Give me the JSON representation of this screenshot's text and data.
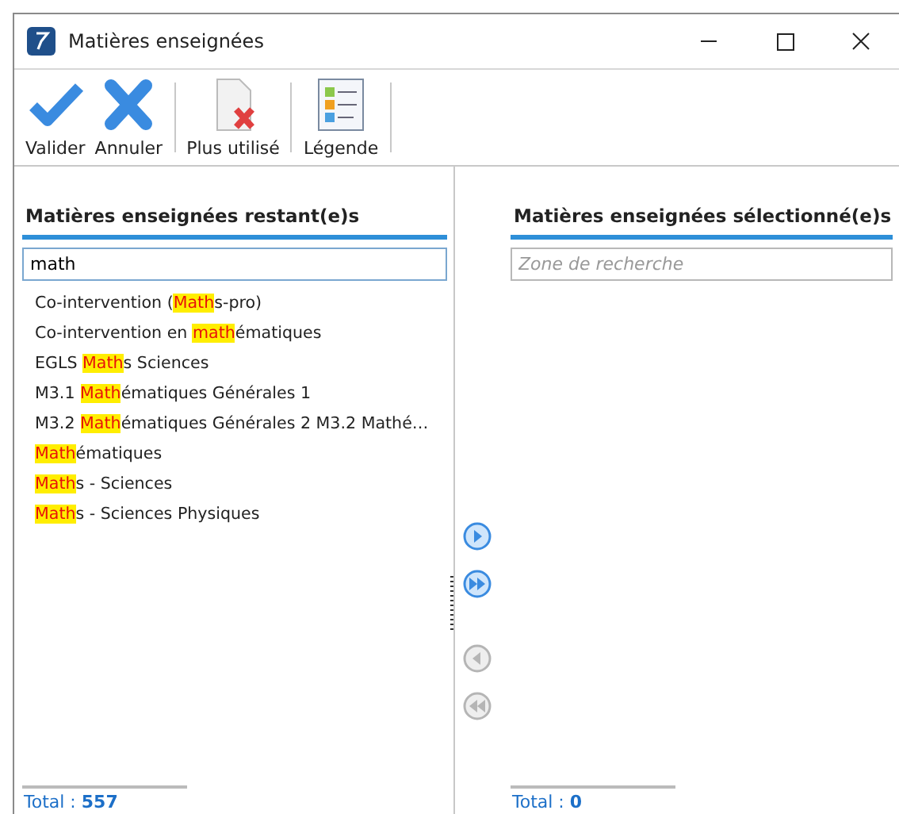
{
  "window": {
    "title": "Matières enseignées"
  },
  "toolbar": [
    {
      "kind": "validate",
      "label": "Valider"
    },
    {
      "kind": "cancel",
      "label": "Annuler"
    },
    {
      "kind": "unused",
      "label": "Plus utilisé"
    },
    {
      "kind": "legend",
      "label": "Légende"
    }
  ],
  "left_panel": {
    "title": "Matières enseignées restant(e)s",
    "search": {
      "value": "math"
    },
    "items": [
      {
        "before": "Co-intervention (",
        "match": "Math",
        "after": "s-pro)"
      },
      {
        "before": "Co-intervention en ",
        "match": "math",
        "after": "ématiques"
      },
      {
        "before": "EGLS ",
        "match": "Math",
        "after": "s Sciences"
      },
      {
        "before": "M3.1 ",
        "match": "Math",
        "after": "ématiques Générales 1"
      },
      {
        "before": "M3.2 ",
        "match": "Math",
        "after": "ématiques Générales 2  M3.2 Mathé…"
      },
      {
        "match": "Math",
        "after": "ématiques"
      },
      {
        "match": "Math",
        "after": "s - Sciences"
      },
      {
        "match": "Math",
        "after": "s - Sciences Physiques"
      }
    ],
    "total": "Total : **557**"
  },
  "transfer_buttons": [
    {
      "kind": "add",
      "disabled": false
    },
    {
      "kind": "add_all",
      "disabled": false
    },
    {
      "kind": "remove",
      "disabled": true
    },
    {
      "kind": "remove_all",
      "disabled": true
    }
  ],
  "right_panel": {
    "title": "Matières enseignées sélectionné(e)s",
    "search": {
      "placeholder": "Zone de recherche"
    },
    "total": "Total : **0**"
  }
}
